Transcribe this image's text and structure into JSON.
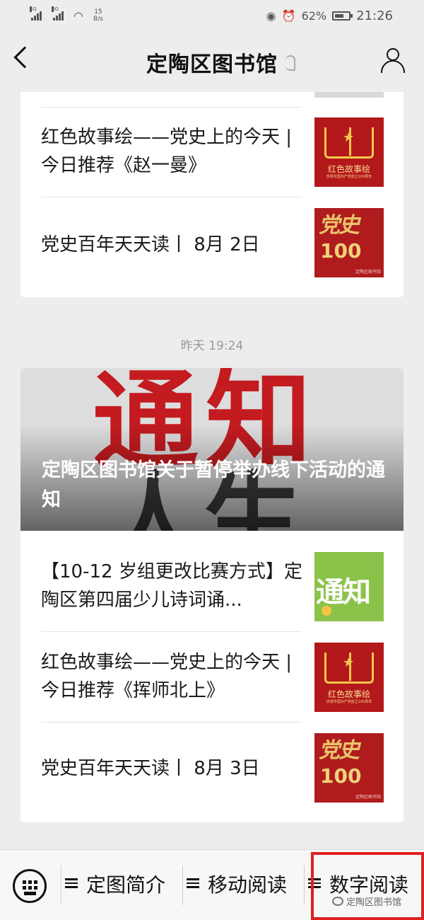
{
  "status_bar": {
    "signal1": "4G",
    "signal2": "4G",
    "net_speed_value": "15",
    "net_speed_unit": "B/s",
    "battery": "62%",
    "time": "21:26"
  },
  "nav": {
    "title": "定陶区图书馆"
  },
  "card1": {
    "items": [
      {
        "title": "红色故事绘——党史上的今天 | 今日推荐《赵一曼》",
        "thumb_caption": "红色故事绘",
        "thumb_sub": "庆祝中国共产党成立100周年"
      },
      {
        "title": "党史百年天天读丨 8月 2日",
        "thumb_top": "党史",
        "thumb_num": "100",
        "thumb_tag": "定陶区图书馆"
      }
    ]
  },
  "timestamp": "昨天 19:24",
  "card2": {
    "hero_image_text_top": "通知",
    "hero_image_text_bottom": "人生",
    "hero_title": "定陶区图书馆关于暂停举办线下活动的通知",
    "items": [
      {
        "title": "【10-12 岁组更改比赛方式】定陶区第四届少儿诗词诵...",
        "thumb_text": "通知"
      },
      {
        "title": "红色故事绘——党史上的今天 | 今日推荐《挥师北上》",
        "thumb_caption": "红色故事绘",
        "thumb_sub": "庆祝中国共产党成立100周年"
      },
      {
        "title": "党史百年天天读丨 8月 3日",
        "thumb_top": "党史",
        "thumb_num": "100",
        "thumb_tag": "定陶区图书馆"
      }
    ]
  },
  "bottom_menu": {
    "items": [
      {
        "label": "定图简介"
      },
      {
        "label": "移动阅读"
      },
      {
        "label": "数字阅读"
      }
    ],
    "watermark": "定陶区图书馆",
    "highlight_color": "#e02020"
  }
}
